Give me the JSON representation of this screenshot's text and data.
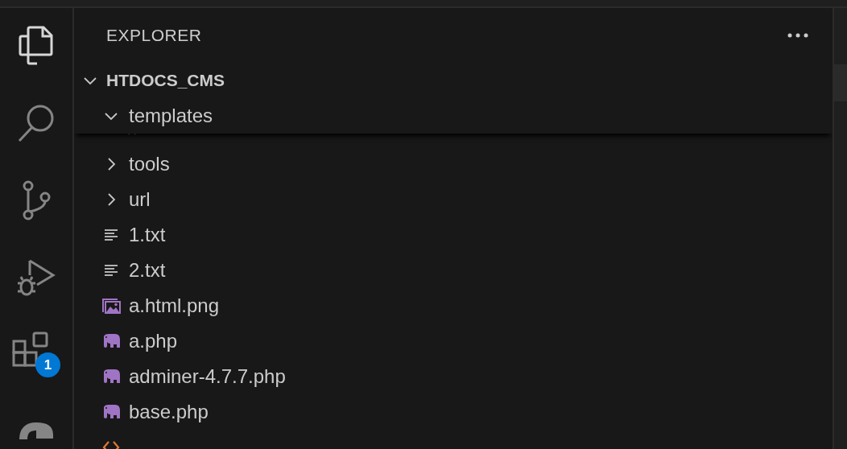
{
  "activity_bar": {
    "items": [
      {
        "kind": "files",
        "selected": true
      },
      {
        "kind": "search",
        "selected": false
      },
      {
        "kind": "source-control",
        "selected": false
      },
      {
        "kind": "run-debug",
        "selected": false
      },
      {
        "kind": "extensions",
        "selected": false,
        "badge": "1"
      },
      {
        "kind": "account",
        "selected": false
      }
    ]
  },
  "explorer": {
    "title": "EXPLORER",
    "root": {
      "name": "HTDOCS_CMS",
      "expanded": true,
      "children": [
        {
          "name": "templates",
          "kind": "folder",
          "expanded": true,
          "children": [
            {
              "kind": "html"
            }
          ]
        },
        {
          "name": "tools",
          "kind": "folder",
          "expanded": false
        },
        {
          "name": "url",
          "kind": "folder",
          "expanded": false
        },
        {
          "name": "1.txt",
          "kind": "txt"
        },
        {
          "name": "2.txt",
          "kind": "txt"
        },
        {
          "name": "a.html.png",
          "kind": "image"
        },
        {
          "name": "a.php",
          "kind": "php"
        },
        {
          "name": "adminer-4.7.7.php",
          "kind": "php"
        },
        {
          "name": "base.php",
          "kind": "php"
        },
        {
          "kind": "html"
        }
      ]
    }
  }
}
